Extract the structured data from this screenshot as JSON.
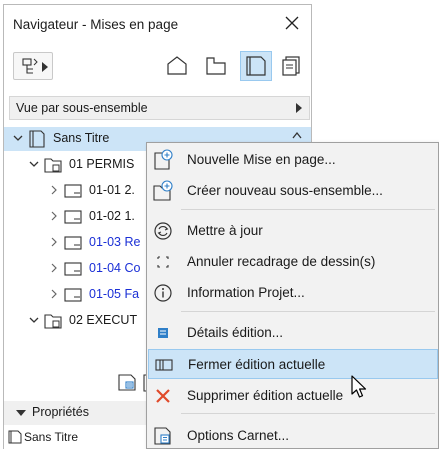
{
  "navigator": {
    "title": "Navigateur - Mises en page",
    "view_select": "Vue par sous-ensemble",
    "tree": [
      {
        "label": "Sans Titre",
        "level": 0,
        "expanded": true,
        "selected": true,
        "color": "black"
      },
      {
        "label": "01 PERMIS",
        "level": 1,
        "expanded": true,
        "color": "black"
      },
      {
        "label": "01-01 2.",
        "level": 2,
        "color": "black"
      },
      {
        "label": "01-02 1.",
        "level": 2,
        "color": "black"
      },
      {
        "label": "01-03 Re",
        "level": 2,
        "color": "blue"
      },
      {
        "label": "01-04 Co",
        "level": 2,
        "color": "blue"
      },
      {
        "label": "01-05 Fa",
        "level": 2,
        "color": "blue"
      },
      {
        "label": "02 EXECUT",
        "level": 1,
        "expanded": true,
        "color": "black"
      }
    ],
    "properties_label": "Propriétés",
    "properties_item": "Sans Titre"
  },
  "context_menu": {
    "items": [
      {
        "label": "Nouvelle Mise en page...",
        "icon": "new-layout-icon"
      },
      {
        "label": "Créer nouveau sous-ensemble...",
        "icon": "new-subset-icon"
      },
      {
        "label": "Mettre à jour",
        "icon": "refresh-icon"
      },
      {
        "label": "Annuler recadrage de dessin(s)",
        "icon": "crop-cancel-icon"
      },
      {
        "label": "Information Projet...",
        "icon": "info-icon"
      },
      {
        "label": "Détails édition...",
        "icon": "issue-details-icon"
      },
      {
        "label": "Fermer édition actuelle",
        "icon": "close-issue-icon",
        "highlighted": true
      },
      {
        "label": "Supprimer édition actuelle",
        "icon": "delete-x-icon"
      },
      {
        "label": "Options Carnet...",
        "icon": "book-options-icon"
      }
    ]
  },
  "colors": {
    "selection": "#cce4f7",
    "selection_border": "#99c9ef",
    "blue_text": "#1a2fd6",
    "delete_red": "#e04a2a",
    "icon_blue": "#2f7fc8"
  }
}
